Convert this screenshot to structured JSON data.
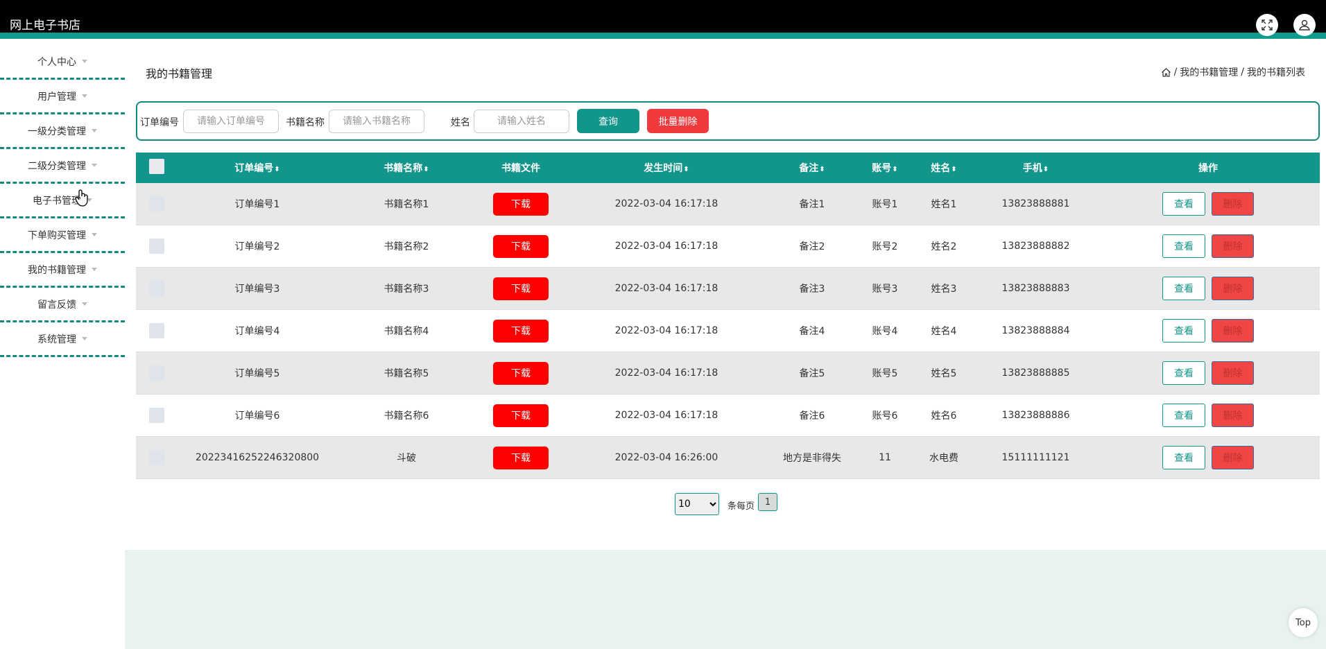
{
  "app": {
    "title": "网上电子书店"
  },
  "header": {
    "fullscreen_icon": "expand-icon",
    "user_icon": "user-icon"
  },
  "sidebar": {
    "items": [
      {
        "label": "个人中心"
      },
      {
        "label": "用户管理"
      },
      {
        "label": "一级分类管理"
      },
      {
        "label": "二级分类管理"
      },
      {
        "label": "电子书管理"
      },
      {
        "label": "下单购买管理"
      },
      {
        "label": "我的书籍管理"
      },
      {
        "label": "留言反馈"
      },
      {
        "label": "系统管理"
      }
    ]
  },
  "page": {
    "title": "我的书籍管理"
  },
  "breadcrumb": {
    "home_icon": "home-icon",
    "sep": "/",
    "level1": "我的书籍管理",
    "level2": "我的书籍列表"
  },
  "search": {
    "order_label": "订单编号",
    "order_placeholder": "请输入订单编号",
    "book_label": "书籍名称",
    "book_placeholder": "请输入书籍名称",
    "name_label": "姓名",
    "name_placeholder": "请输入姓名",
    "query_button": "查询",
    "batch_delete_button": "批量删除"
  },
  "table": {
    "columns": {
      "order": "订单编号",
      "book": "书籍名称",
      "file": "书籍文件",
      "time": "发生时间",
      "note": "备注",
      "account": "账号",
      "name": "姓名",
      "phone": "手机",
      "actions": "操作"
    },
    "sort_glyph": "⬍",
    "download_label": "下载",
    "view_label": "查看",
    "delete_label": "删除",
    "rows": [
      {
        "order": "订单编号1",
        "book": "书籍名称1",
        "time": "2022-03-04 16:17:18",
        "note": "备注1",
        "account": "账号1",
        "name": "姓名1",
        "phone": "13823888881"
      },
      {
        "order": "订单编号2",
        "book": "书籍名称2",
        "time": "2022-03-04 16:17:18",
        "note": "备注2",
        "account": "账号2",
        "name": "姓名2",
        "phone": "13823888882"
      },
      {
        "order": "订单编号3",
        "book": "书籍名称3",
        "time": "2022-03-04 16:17:18",
        "note": "备注3",
        "account": "账号3",
        "name": "姓名3",
        "phone": "13823888883"
      },
      {
        "order": "订单编号4",
        "book": "书籍名称4",
        "time": "2022-03-04 16:17:18",
        "note": "备注4",
        "account": "账号4",
        "name": "姓名4",
        "phone": "13823888884"
      },
      {
        "order": "订单编号5",
        "book": "书籍名称5",
        "time": "2022-03-04 16:17:18",
        "note": "备注5",
        "account": "账号5",
        "name": "姓名5",
        "phone": "13823888885"
      },
      {
        "order": "订单编号6",
        "book": "书籍名称6",
        "time": "2022-03-04 16:17:18",
        "note": "备注6",
        "account": "账号6",
        "name": "姓名6",
        "phone": "13823888886"
      },
      {
        "order": "20223416252246320800",
        "book": "斗破",
        "time": "2022-03-04 16:26:00",
        "note": "地方是非得失",
        "account": "11",
        "name": "水电费",
        "phone": "15111111121"
      }
    ]
  },
  "pagination": {
    "page_size": "10",
    "page_size_options": [
      "10"
    ],
    "per_page_label": "条每页",
    "current_page": "1"
  },
  "back_to_top": {
    "label": "Top"
  },
  "colors": {
    "primary": "#12958a",
    "danger": "#f0393c",
    "download": "#ff0000",
    "header_bg": "#000000"
  }
}
